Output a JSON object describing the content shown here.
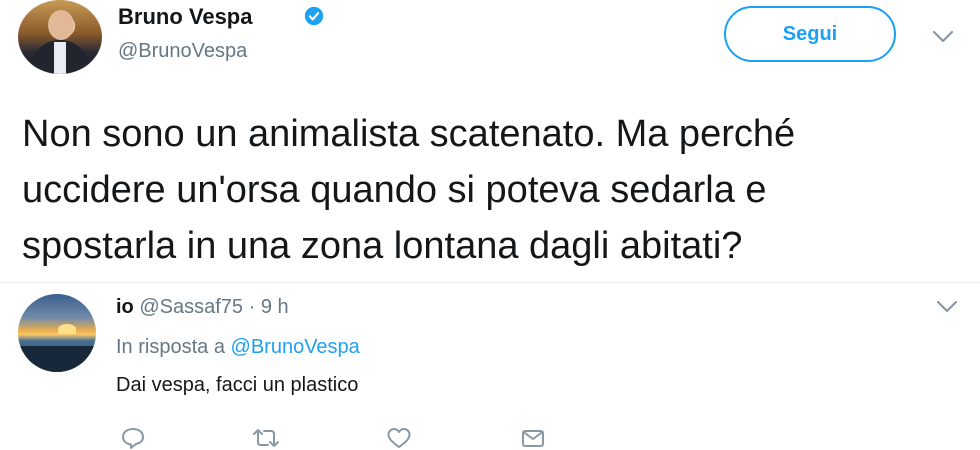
{
  "tweet": {
    "author": {
      "name": "Bruno Vespa",
      "handle": "@BrunoVespa",
      "verified": true
    },
    "follow_label": "Segui",
    "text_lines": [
      "Non sono un animalista scatenato. Ma perché",
      "uccidere un'orsa quando si poteva sedarla e",
      "spostarla in una zona lontana dagli abitati?"
    ]
  },
  "reply": {
    "name": "io",
    "handle": "@Sassaf75",
    "separator": "·",
    "time": "9 h",
    "in_reply_prefix": "In risposta a",
    "in_reply_mention": "@BrunoVespa",
    "text": "Dai vespa, facci un plastico",
    "actions": [
      "reply-icon",
      "retweet-icon",
      "like-icon",
      "message-icon"
    ]
  },
  "colors": {
    "accent": "#1da1f2",
    "secondary_text": "#657786",
    "primary_text": "#14171a"
  }
}
